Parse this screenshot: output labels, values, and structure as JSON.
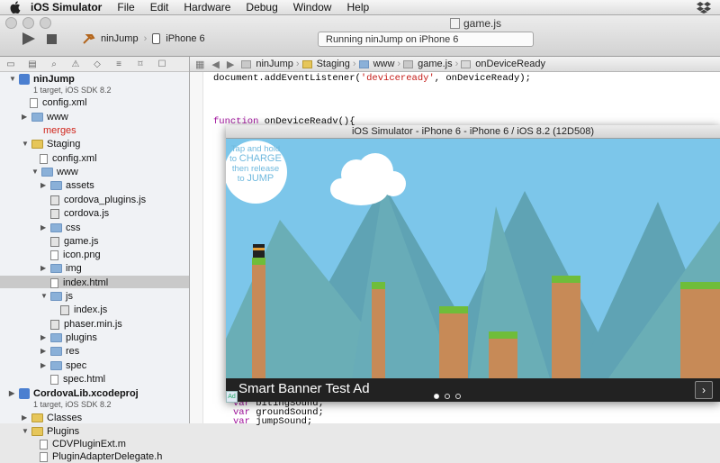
{
  "menubar": {
    "app": "iOS Simulator",
    "items": [
      "File",
      "Edit",
      "Hardware",
      "Debug",
      "Window",
      "Help"
    ]
  },
  "window": {
    "file_title": "game.js"
  },
  "toolbar": {
    "project": "ninJump",
    "device": "iPhone 6",
    "status": "Running ninJump on iPhone 6"
  },
  "jumpbar": [
    "ninJump",
    "Staging",
    "www",
    "game.js",
    "onDeviceReady"
  ],
  "tree": [
    {
      "label": "ninJump",
      "sub": "1 target, iOS SDK 8.2"
    },
    {
      "label": "config.xml"
    },
    {
      "label": "www"
    },
    {
      "label": "merges"
    },
    {
      "label": "Staging"
    },
    {
      "label": "config.xml"
    },
    {
      "label": "www"
    },
    {
      "label": "assets"
    },
    {
      "label": "cordova_plugins.js"
    },
    {
      "label": "cordova.js"
    },
    {
      "label": "css"
    },
    {
      "label": "game.js"
    },
    {
      "label": "icon.png"
    },
    {
      "label": "img"
    },
    {
      "label": "index.html"
    },
    {
      "label": "js"
    },
    {
      "label": "index.js"
    },
    {
      "label": "phaser.min.js"
    },
    {
      "label": "plugins"
    },
    {
      "label": "res"
    },
    {
      "label": "spec"
    },
    {
      "label": "spec.html"
    },
    {
      "label": "CordovaLib.xcodeproj",
      "sub": "1 target, iOS SDK 8.2"
    },
    {
      "label": "Classes"
    },
    {
      "label": "Plugins"
    },
    {
      "label": "CDVPluginExt.m"
    },
    {
      "label": "PluginAdapterDelegate.h"
    }
  ],
  "code": {
    "line1_a": "document.addEventListener(",
    "line1_str": "'deviceready'",
    "line1_b": ", onDeviceReady);",
    "line2_kw": "function",
    "line2_rest": " onDeviceReadv(){",
    "line3_kw": "var",
    "line3_rest": " bitingSound;",
    "line4_kw": "var",
    "line4_rest": " groundSound;",
    "line5_kw": "var",
    "line5_rest": " jumpSound;"
  },
  "simulator": {
    "title": "iOS Simulator - iPhone 6 - iPhone 6 / iOS 8.2 (12D508)",
    "bubble_line1": "Tap and hold",
    "bubble_line2": "to",
    "bubble_charge": "CHARGE",
    "bubble_line3": "then release",
    "bubble_line4": "to",
    "bubble_jump": "JUMP",
    "ad_text": "Smart Banner Test Ad",
    "ad_badge": "Ad",
    "ad_arrow": "›"
  }
}
